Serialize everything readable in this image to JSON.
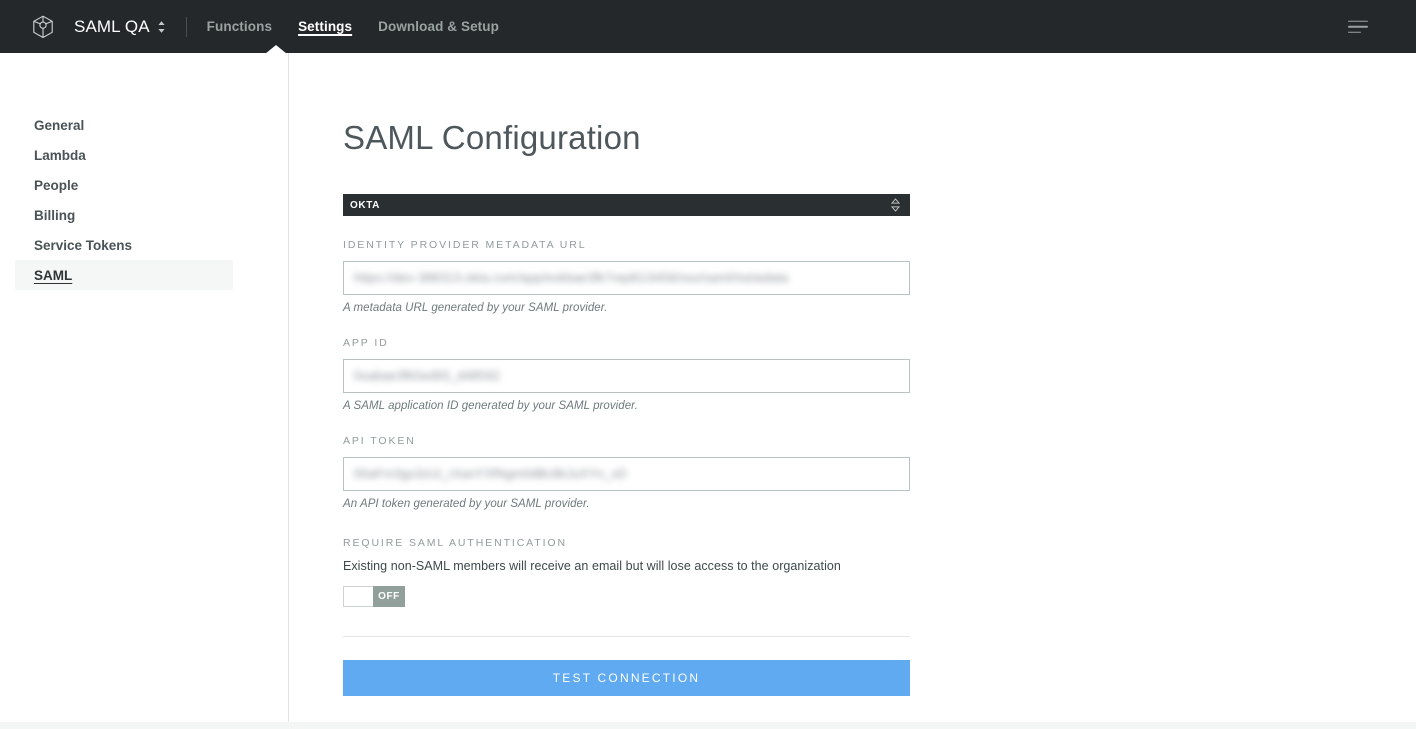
{
  "header": {
    "logo_icon": "cube-logo-icon",
    "org_name": "SAML QA",
    "org_switcher_icon": "chevron-up-down-icon",
    "nav": [
      {
        "label": "Functions",
        "active": false
      },
      {
        "label": "Settings",
        "active": true
      },
      {
        "label": "Download & Setup",
        "active": false
      }
    ],
    "menu_icon": "hamburger-menu-icon"
  },
  "sidebar": {
    "items": [
      {
        "label": "General",
        "active": false
      },
      {
        "label": "Lambda",
        "active": false
      },
      {
        "label": "People",
        "active": false
      },
      {
        "label": "Billing",
        "active": false
      },
      {
        "label": "Service Tokens",
        "active": false
      },
      {
        "label": "SAML",
        "active": true
      }
    ]
  },
  "main": {
    "title": "SAML Configuration",
    "provider_select": {
      "value": "OKTA",
      "caret_icon": "chevron-up-down-icon"
    },
    "fields": [
      {
        "label": "IDENTITY PROVIDER METADATA URL",
        "value": "https://dev-388313.okta.com/app/exkbae3fk7rep81i3456/sso/saml/metadata",
        "help": "A metadata URL generated by your SAML provider."
      },
      {
        "label": "APP ID",
        "value": "0oabae3fk5ed93_d48592",
        "help": "A SAML application ID generated by your SAML provider."
      },
      {
        "label": "API TOKEN",
        "value": "00aFrn3gx3zUi_rXanYXfNgm0dBc8kJuXYn_xD",
        "help": "An API token generated by your SAML provider."
      }
    ],
    "require_saml": {
      "label": "REQUIRE SAML AUTHENTICATION",
      "description": "Existing non-SAML members will receive an email but will lose access to the organization",
      "toggle_state": "OFF"
    },
    "test_button": "TEST CONNECTION"
  },
  "colors": {
    "header_bg": "#24282a",
    "accent_button": "#5faaf0",
    "select_bg": "#2a2f31",
    "toggle_off": "#92a09c",
    "active_sidebar_bg": "#f5f6f6"
  }
}
